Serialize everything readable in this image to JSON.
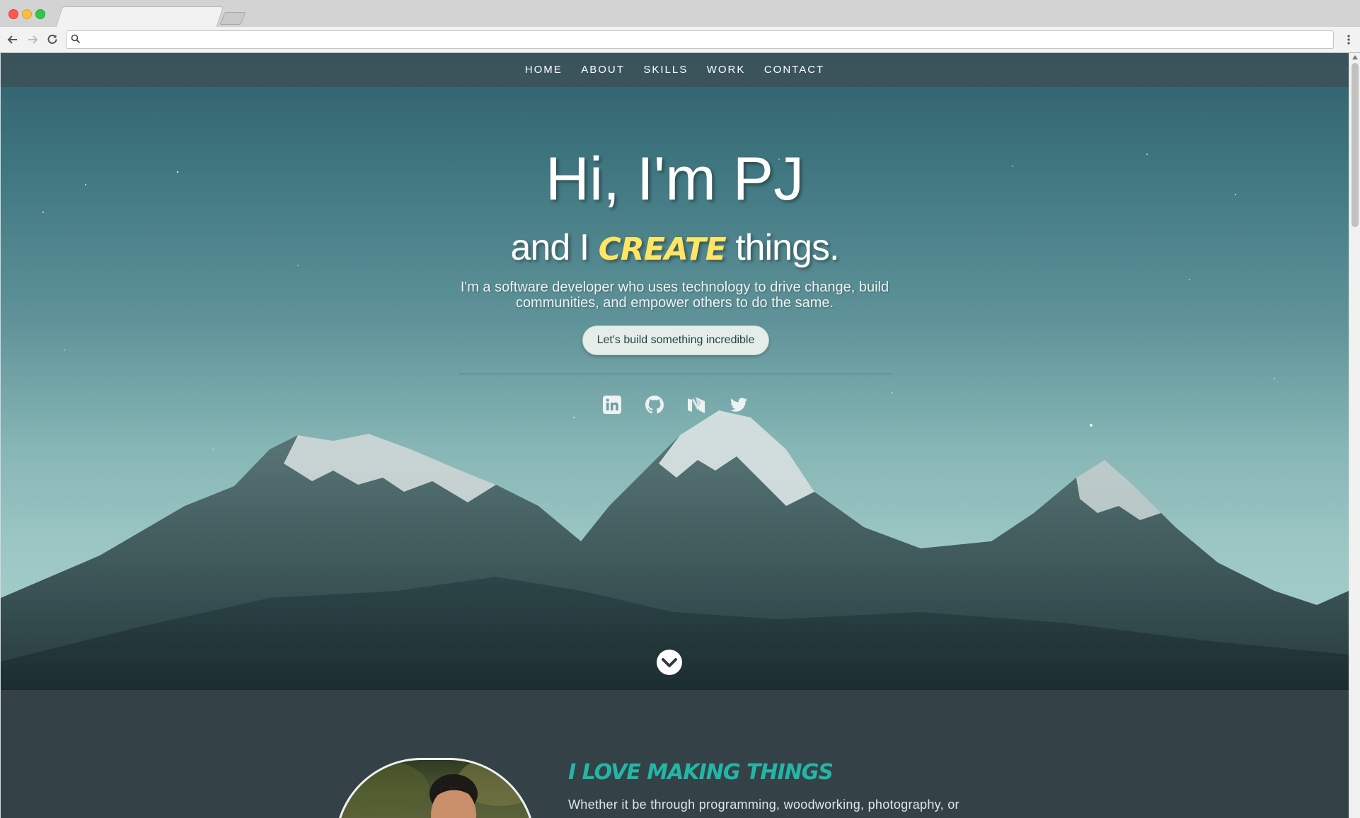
{
  "browser": {
    "url": "",
    "icons": {
      "back": "back-arrow-icon",
      "forward": "forward-arrow-icon",
      "reload": "reload-icon",
      "search": "search-icon",
      "menu": "kebab-menu-icon"
    }
  },
  "nav": {
    "items": [
      {
        "label": "HOME"
      },
      {
        "label": "ABOUT"
      },
      {
        "label": "SKILLS"
      },
      {
        "label": "WORK"
      },
      {
        "label": "CONTACT"
      }
    ]
  },
  "hero": {
    "title": "Hi, I'm PJ",
    "subtitle_before": "and I",
    "subtitle_highlight": "create",
    "subtitle_after": "things.",
    "description": "I'm a software developer who uses technology to drive change, build communities, and empower others to do the same.",
    "cta_label": "Let's build something incredible",
    "social_icons": [
      "linkedin-icon",
      "github-icon",
      "medium-icon",
      "twitter-icon"
    ],
    "highlight_color": "#ffe563"
  },
  "about": {
    "heading": "I love making things",
    "text": "Whether it be through programming, woodworking, photography, or",
    "heading_color": "#23b6a6"
  },
  "colors": {
    "nav_bg": "#3e5056",
    "section_bg": "#344247",
    "cta_bg": "#e4ede7"
  }
}
